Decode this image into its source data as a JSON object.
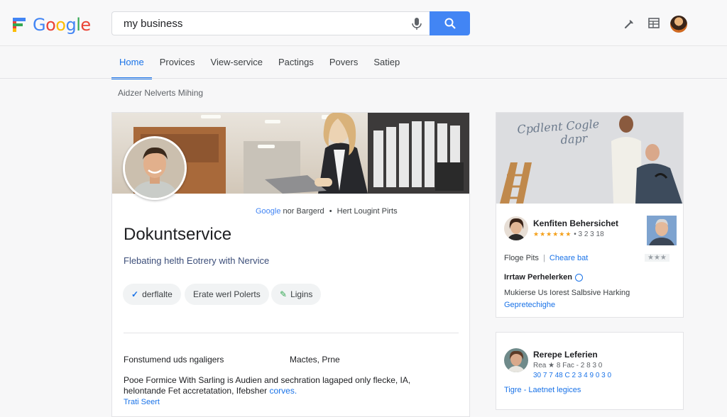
{
  "header": {
    "logo_text": "Google",
    "search": {
      "value": "my business"
    },
    "icons": [
      "wrench-icon",
      "grid-icon",
      "account-avatar"
    ]
  },
  "tabs": [
    {
      "label": "Home",
      "active": true
    },
    {
      "label": "Provices"
    },
    {
      "label": "View-service"
    },
    {
      "label": "Pactings"
    },
    {
      "label": "Povers"
    },
    {
      "label": "Satiep"
    }
  ],
  "subtitle": "Aidzer Nelverts Mihing",
  "business_card": {
    "meta_brand": "Google",
    "meta_text": "nor Bargerd",
    "meta_sep": "•",
    "meta_text2": "Hert Lougint Pirts",
    "title": "Dokuntservice",
    "description": "Flebating helth Eotrery with Nervice",
    "chips": [
      {
        "icon": "✓",
        "label": "derflalte"
      },
      {
        "icon": "",
        "label": "Erate werl Polerts"
      },
      {
        "icon": "✎",
        "label": "Ligins"
      }
    ],
    "section_left": "Fonstumend uds ngaligers",
    "section_right": "Mactes, Prne",
    "body_line1": "Pooe Formice With Sarling is Audien and sechration lagaped only flecke, IA,",
    "body_line2_a": "helontande Fet accretatation, Ifebsher",
    "body_line2_b": "corves.",
    "link": "Trati Seert"
  },
  "side_card": {
    "hero_text_line1": "Cpdlent Cogle",
    "hero_text_line2": "dapr",
    "name": "Kenfiten Behersichet",
    "stars": "★★★★★★",
    "rating_text": "• 3 2 3 18",
    "row_text": "Floge Pits",
    "row_sep": "|",
    "row_link": "Cheare bat",
    "row_stars": "★★★",
    "heading": "Irrtaw Perhelerken",
    "paragraph": "Mukierse Us Iorest Salbsive Harking",
    "link": "Gepretechighe"
  },
  "side_card2": {
    "name": "Rerepe Leferien",
    "rating_line": "Rea ★ 8 Fac - 2 8 3 0",
    "number_line": "30 7 7 48 C 2 3 4 9 0 3 0",
    "link": "Tigre - Laetnet legices"
  }
}
